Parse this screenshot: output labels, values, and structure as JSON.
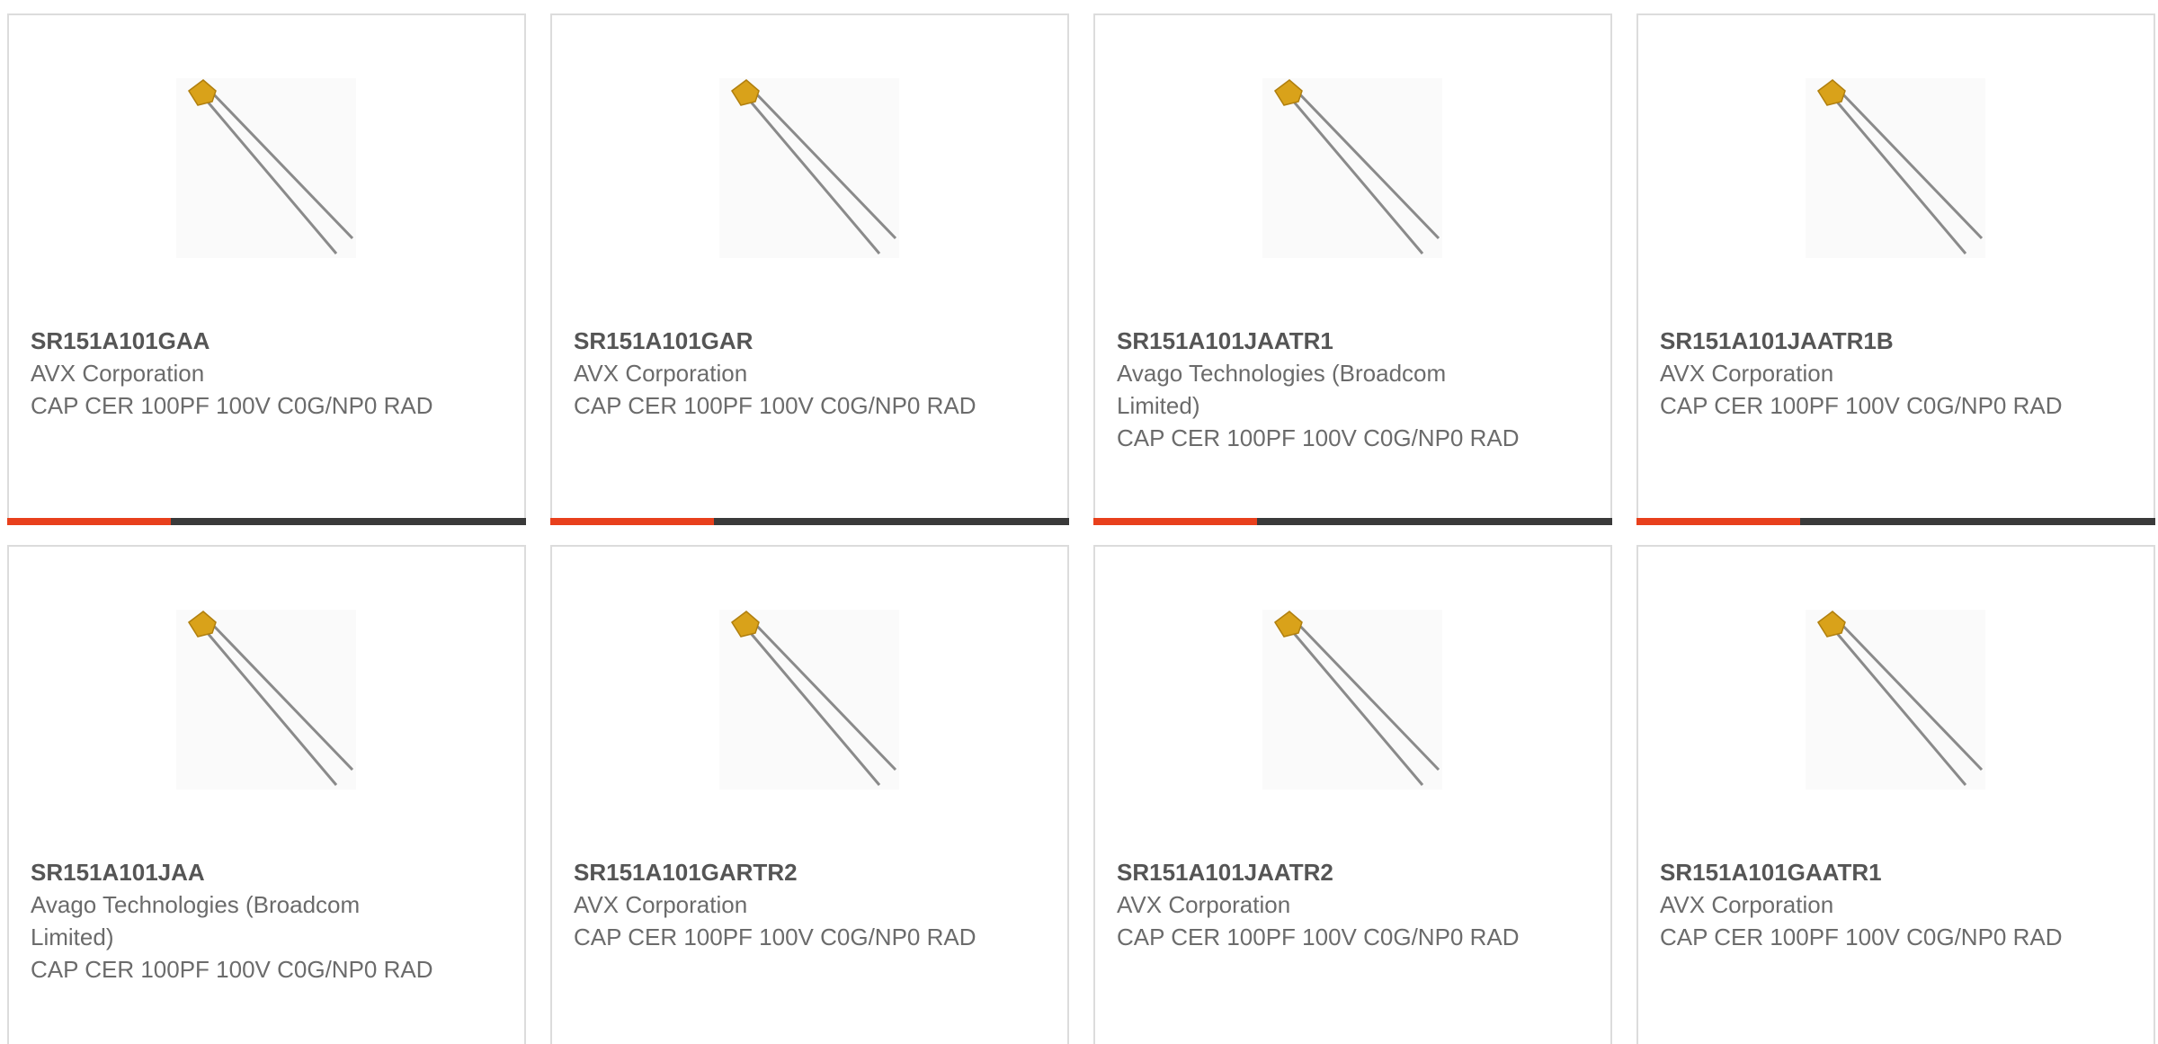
{
  "products": [
    {
      "part_number": "SR151A101GAA",
      "manufacturer": "AVX Corporation",
      "description": "CAP CER 100PF 100V C0G/NP0 RAD",
      "image_icon": "ceramic-capacitor-icon"
    },
    {
      "part_number": "SR151A101GAR",
      "manufacturer": "AVX Corporation",
      "description": "CAP CER 100PF 100V C0G/NP0 RAD",
      "image_icon": "ceramic-capacitor-icon"
    },
    {
      "part_number": "SR151A101JAATR1",
      "manufacturer": "Avago Technologies (Broadcom Limited)",
      "description": "CAP CER 100PF 100V C0G/NP0 RAD",
      "image_icon": "ceramic-capacitor-icon"
    },
    {
      "part_number": "SR151A101JAATR1B",
      "manufacturer": "AVX Corporation",
      "description": "CAP CER 100PF 100V C0G/NP0 RAD",
      "image_icon": "ceramic-capacitor-icon"
    },
    {
      "part_number": "SR151A101JAA",
      "manufacturer": "Avago Technologies (Broadcom Limited)",
      "description": "CAP CER 100PF 100V C0G/NP0 RAD",
      "image_icon": "ceramic-capacitor-icon"
    },
    {
      "part_number": "SR151A101GARTR2",
      "manufacturer": "AVX Corporation",
      "description": "CAP CER 100PF 100V C0G/NP0 RAD",
      "image_icon": "ceramic-capacitor-icon"
    },
    {
      "part_number": "SR151A101JAATR2",
      "manufacturer": "AVX Corporation",
      "description": "CAP CER 100PF 100V C0G/NP0 RAD",
      "image_icon": "ceramic-capacitor-icon"
    },
    {
      "part_number": "SR151A101GAATR1",
      "manufacturer": "AVX Corporation",
      "description": "CAP CER 100PF 100V C0G/NP0 RAD",
      "image_icon": "ceramic-capacitor-icon"
    }
  ],
  "colors": {
    "accent": "#e8401c",
    "bar": "#3a3a3a",
    "capacitor_body": "#d9a21a",
    "text": "#6b6b6b",
    "part_text": "#555555"
  }
}
